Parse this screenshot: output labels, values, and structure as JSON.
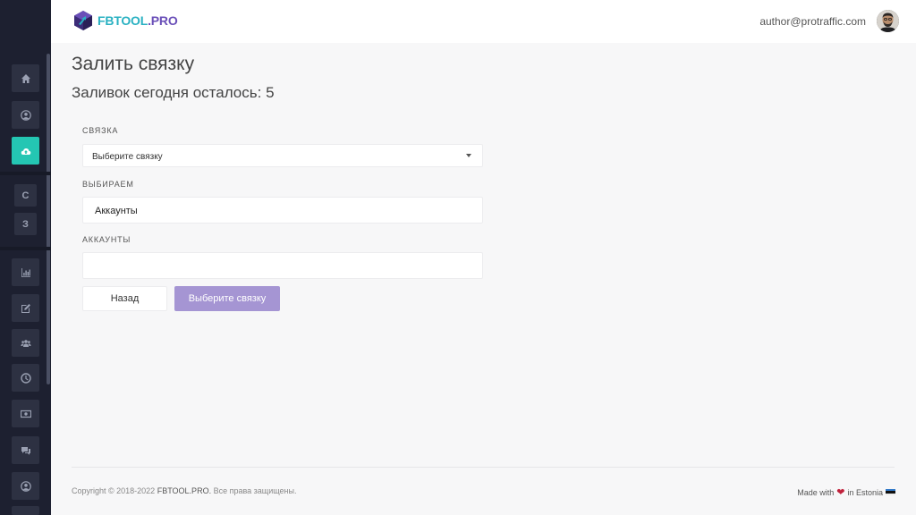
{
  "header": {
    "logo_part1": "FBTOOL",
    "logo_part2": ".PRO",
    "user_email": "author@protraffic.com"
  },
  "sidebar": {
    "items": [
      {
        "icon": "home-icon",
        "label": ""
      },
      {
        "icon": "user-circle-icon",
        "label": ""
      },
      {
        "icon": "cloud-upload-icon",
        "label": "",
        "active": true
      },
      {
        "icon": "",
        "label": "С"
      },
      {
        "icon": "",
        "label": "З"
      },
      {
        "icon": "bar-chart-icon",
        "label": ""
      },
      {
        "icon": "edit-icon",
        "label": ""
      },
      {
        "icon": "users-icon",
        "label": ""
      },
      {
        "icon": "clock-icon",
        "label": ""
      },
      {
        "icon": "money-icon",
        "label": ""
      },
      {
        "icon": "comments-icon",
        "label": ""
      },
      {
        "icon": "user-icon",
        "label": ""
      }
    ],
    "active_color": "#24c6b3"
  },
  "main": {
    "title": "Залить связку",
    "subtitle": "Заливок сегодня осталось: 5",
    "bundle_label": "СВЯЗКА",
    "bundle_select_value": "Выберите связку",
    "choose_label": "ВЫБИРАЕМ",
    "choose_value": "Аккаунты",
    "accounts_label": "АККАУНТЫ",
    "accounts_value": "",
    "back_button": "Назад",
    "submit_button": "Выберите связку",
    "submit_color": "#a595d3"
  },
  "footer": {
    "copyright_prefix": "Copyright © 2018-2022",
    "copyright_brand": "FBTOOL.PRO.",
    "copyright_suffix": "Все права защищены.",
    "made_with": "Made with",
    "made_in": "in Estonia"
  }
}
